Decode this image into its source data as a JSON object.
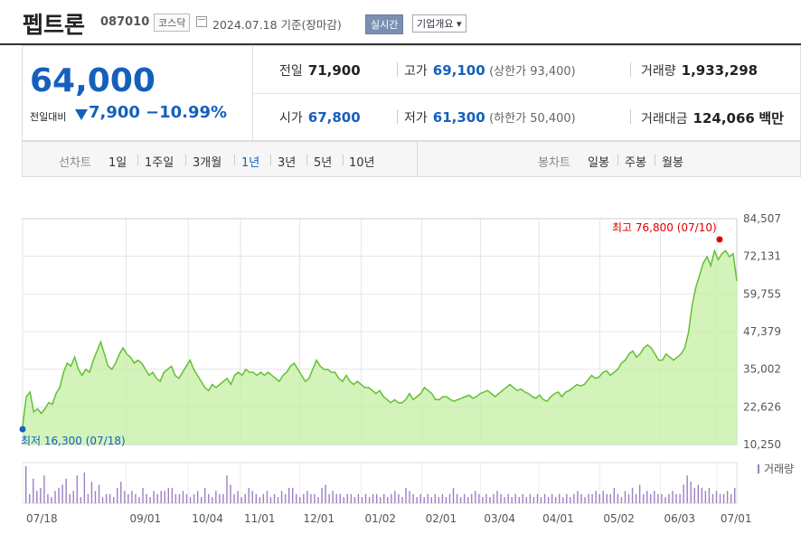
{
  "header": {
    "stock_name": "펩트론",
    "stock_code": "087010",
    "market": "코스닥",
    "date_text": "2024.07.18 기준(장마감)",
    "realtime_label": "실시간",
    "corp_overview_label": "기업개요 ▾"
  },
  "summary": {
    "price": "64,000",
    "change_label": "전일대비",
    "change_value": "7,900",
    "change_percent": "−10.99%",
    "prev_close_label": "전일",
    "prev_close": "71,900",
    "high_label": "고가",
    "high": "69,100",
    "upper_limit_text": "(상한가 93,400)",
    "volume_label": "거래량",
    "volume": "1,933,298",
    "open_label": "시가",
    "open": "67,800",
    "low_label": "저가",
    "low": "61,300",
    "lower_limit_text": "(하한가 50,400)",
    "value_label": "거래대금",
    "value": "124,066",
    "value_unit": "백만"
  },
  "tabs": {
    "line_label": "선차트",
    "periods": [
      "1일",
      "1주일",
      "3개월",
      "1년",
      "3년",
      "5년",
      "10년"
    ],
    "active_period": "1년",
    "candle_label": "봉차트",
    "candles": [
      "일봉",
      "주봉",
      "월봉"
    ]
  },
  "colors": {
    "up": "#e00000",
    "down": "#1560bd",
    "line": "#64c032",
    "fill": "#c8f0aa",
    "volume": "#9b7fc4"
  },
  "chart_data": {
    "type": "area",
    "yticks": [
      "84,507",
      "72,131",
      "59,755",
      "47,379",
      "35,002",
      "22,626",
      "10,250"
    ],
    "ylim": [
      10250,
      84507
    ],
    "xticks": [
      "07/18",
      "09/01",
      "10/04",
      "11/01",
      "12/01",
      "01/02",
      "02/01",
      "03/04",
      "04/01",
      "05/02",
      "06/03",
      "07/01"
    ],
    "high_annotation": "최고 76,800 (07/10)",
    "low_annotation": "최저 16,300 (07/18)",
    "volume_legend": "거래량",
    "series": [
      {
        "values": [
          16300,
          26000,
          27500,
          21000,
          22000,
          20500,
          22000,
          24000,
          23500,
          27000,
          29000,
          34000,
          37000,
          36000,
          39000,
          35000,
          33000,
          35000,
          34000,
          38000,
          41000,
          44000,
          40000,
          36000,
          35000,
          37000,
          40000,
          42000,
          40000,
          39000,
          37000,
          38000,
          37000,
          35000,
          33000,
          34000,
          32000,
          31000,
          34000,
          35000,
          36000,
          33000,
          32000,
          34000,
          36000,
          38000,
          35000,
          33000,
          31000,
          29000,
          28000,
          30000,
          29000,
          30000,
          31000,
          32000,
          30000,
          33000,
          34000,
          33000,
          35000,
          34000,
          34000,
          33000,
          34000,
          33000,
          34000,
          33000,
          32000,
          31000,
          33000,
          34000,
          36000,
          37000,
          35000,
          33000,
          31000,
          32000,
          35000,
          38000,
          36000,
          35000,
          35000,
          34000,
          34000,
          32000,
          31000,
          33000,
          31000,
          30000,
          31000,
          30000,
          29000,
          29000,
          28000,
          27000,
          28000,
          26000,
          25000,
          24000,
          25000,
          24000,
          24000,
          25000,
          27000,
          25000,
          26000,
          27000,
          29000,
          28000,
          27000,
          25000,
          25000,
          26000,
          26000,
          25000,
          24500,
          25000,
          25500,
          26000,
          26500,
          25500,
          26000,
          27000,
          27500,
          28000,
          27000,
          26000,
          27000,
          28000,
          29000,
          30000,
          29000,
          28000,
          28500,
          27500,
          27000,
          26000,
          25500,
          26500,
          25000,
          24500,
          26000,
          27000,
          27500,
          26000,
          27500,
          28000,
          29000,
          30000,
          29500,
          30000,
          31500,
          33000,
          32000,
          32500,
          34000,
          34500,
          33000,
          34000,
          35000,
          37000,
          38000,
          40000,
          41000,
          39000,
          40000,
          42000,
          43000,
          42000,
          40000,
          38000,
          38000,
          40000,
          39000,
          38000,
          39000,
          40000,
          42000,
          47000,
          56000,
          62000,
          66000,
          70000,
          72000,
          69000,
          74000,
          71000,
          73000,
          74000,
          72000,
          73000,
          64000
        ]
      }
    ],
    "volume_values": [
      1.2,
      0.3,
      0.8,
      0.4,
      0.5,
      0.9,
      0.3,
      0.2,
      0.4,
      0.5,
      0.6,
      0.8,
      0.3,
      0.4,
      0.9,
      0.2,
      1.0,
      0.3,
      0.7,
      0.4,
      0.6,
      0.2,
      0.3,
      0.3,
      0.2,
      0.5,
      0.7,
      0.4,
      0.3,
      0.4,
      0.3,
      0.2,
      0.5,
      0.3,
      0.2,
      0.4,
      0.3,
      0.4,
      0.4,
      0.5,
      0.5,
      0.3,
      0.3,
      0.4,
      0.3,
      0.2,
      0.3,
      0.4,
      0.2,
      0.5,
      0.3,
      0.2,
      0.4,
      0.3,
      0.3,
      0.9,
      0.6,
      0.3,
      0.4,
      0.2,
      0.3,
      0.5,
      0.4,
      0.3,
      0.2,
      0.3,
      0.4,
      0.2,
      0.3,
      0.2,
      0.4,
      0.3,
      0.5,
      0.5,
      0.3,
      0.2,
      0.3,
      0.4,
      0.3,
      0.3,
      0.2,
      0.5,
      0.6,
      0.3,
      0.4,
      0.3,
      0.3,
      0.2,
      0.3,
      0.3,
      0.2,
      0.3,
      0.2,
      0.3,
      0.2,
      0.3,
      0.3,
      0.2,
      0.3,
      0.2,
      0.3,
      0.4,
      0.3,
      0.2,
      0.5,
      0.4,
      0.3,
      0.2,
      0.3,
      0.2,
      0.3,
      0.2,
      0.3,
      0.2,
      0.3,
      0.2,
      0.3,
      0.5,
      0.3,
      0.2,
      0.3,
      0.2,
      0.3,
      0.4,
      0.3,
      0.2,
      0.3,
      0.2,
      0.3,
      0.4,
      0.3,
      0.2,
      0.3,
      0.2,
      0.3,
      0.2,
      0.3,
      0.2,
      0.3,
      0.2,
      0.3,
      0.2,
      0.3,
      0.2,
      0.3,
      0.2,
      0.3,
      0.2,
      0.3,
      0.2,
      0.3,
      0.4,
      0.3,
      0.2,
      0.3,
      0.3,
      0.4,
      0.3,
      0.4,
      0.3,
      0.3,
      0.5,
      0.3,
      0.2,
      0.4,
      0.3,
      0.5,
      0.3,
      0.6,
      0.3,
      0.4,
      0.3,
      0.4,
      0.3,
      0.3,
      0.2,
      0.3,
      0.4,
      0.3,
      0.3,
      0.6,
      0.9,
      0.7,
      0.5,
      0.6,
      0.5,
      0.4,
      0.5,
      0.3,
      0.4,
      0.3,
      0.3,
      0.4,
      0.3,
      0.5
    ]
  }
}
